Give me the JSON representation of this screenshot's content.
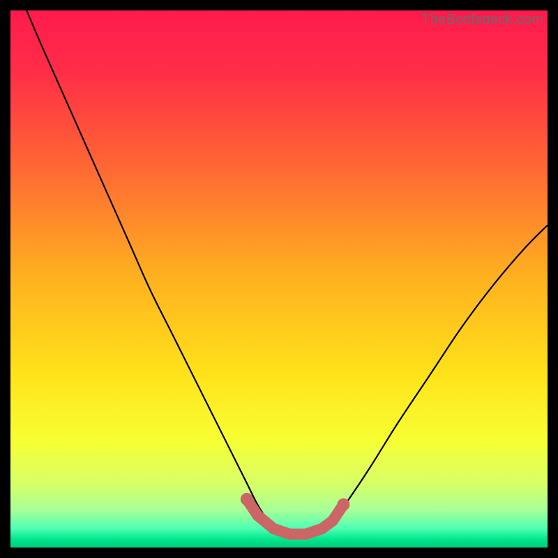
{
  "watermark": "TheBottleneck.com",
  "colors": {
    "frame": "#000000",
    "gradient_stops": [
      {
        "offset": 0.0,
        "color": "#ff1a4d"
      },
      {
        "offset": 0.12,
        "color": "#ff2f47"
      },
      {
        "offset": 0.3,
        "color": "#ff6a33"
      },
      {
        "offset": 0.5,
        "color": "#ffb21f"
      },
      {
        "offset": 0.68,
        "color": "#ffe31a"
      },
      {
        "offset": 0.8,
        "color": "#f7ff33"
      },
      {
        "offset": 0.88,
        "color": "#d8ff66"
      },
      {
        "offset": 0.93,
        "color": "#a8ff99"
      },
      {
        "offset": 0.965,
        "color": "#4dffb3"
      },
      {
        "offset": 0.985,
        "color": "#00e68c"
      },
      {
        "offset": 1.0,
        "color": "#00cc7a"
      }
    ],
    "curve": "#000000",
    "marker": "#cc6666"
  },
  "chart_data": {
    "type": "line",
    "title": "",
    "xlabel": "",
    "ylabel": "",
    "xlim": [
      0,
      100
    ],
    "ylim": [
      0,
      100
    ],
    "series": [
      {
        "name": "bottleneck-curve",
        "x": [
          3,
          6,
          10,
          14,
          18,
          22,
          26,
          30,
          34,
          38,
          41,
          44,
          46,
          48,
          50,
          52,
          54,
          56,
          58,
          60,
          63,
          67,
          72,
          78,
          84,
          90,
          96,
          100
        ],
        "y": [
          100,
          93,
          84,
          75,
          66,
          57,
          48,
          40,
          32,
          24,
          18,
          12,
          8,
          5,
          3,
          2,
          2,
          2,
          3,
          5,
          9,
          15,
          23,
          32,
          41,
          49,
          56,
          60
        ]
      }
    ],
    "markers": [
      {
        "x": 44,
        "y": 9
      },
      {
        "x": 46,
        "y": 6
      },
      {
        "x": 49,
        "y": 3.5
      },
      {
        "x": 52,
        "y": 2.5
      },
      {
        "x": 55,
        "y": 2.5
      },
      {
        "x": 58,
        "y": 3.5
      },
      {
        "x": 60,
        "y": 5
      },
      {
        "x": 62,
        "y": 8
      }
    ]
  }
}
